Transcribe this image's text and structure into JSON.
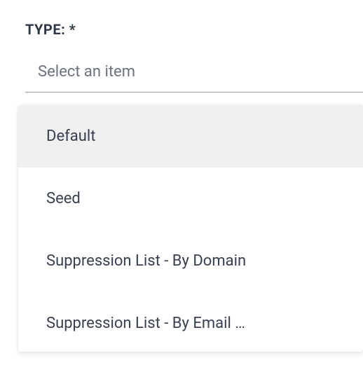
{
  "field": {
    "label": "TYPE: *",
    "placeholder": "Select an item"
  },
  "dropdown": {
    "options": [
      {
        "label": "Default",
        "highlighted": true
      },
      {
        "label": "Seed",
        "highlighted": false
      },
      {
        "label": "Suppression List - By Domain",
        "highlighted": false
      },
      {
        "label": "Suppression List - By Email …",
        "highlighted": false
      }
    ]
  }
}
